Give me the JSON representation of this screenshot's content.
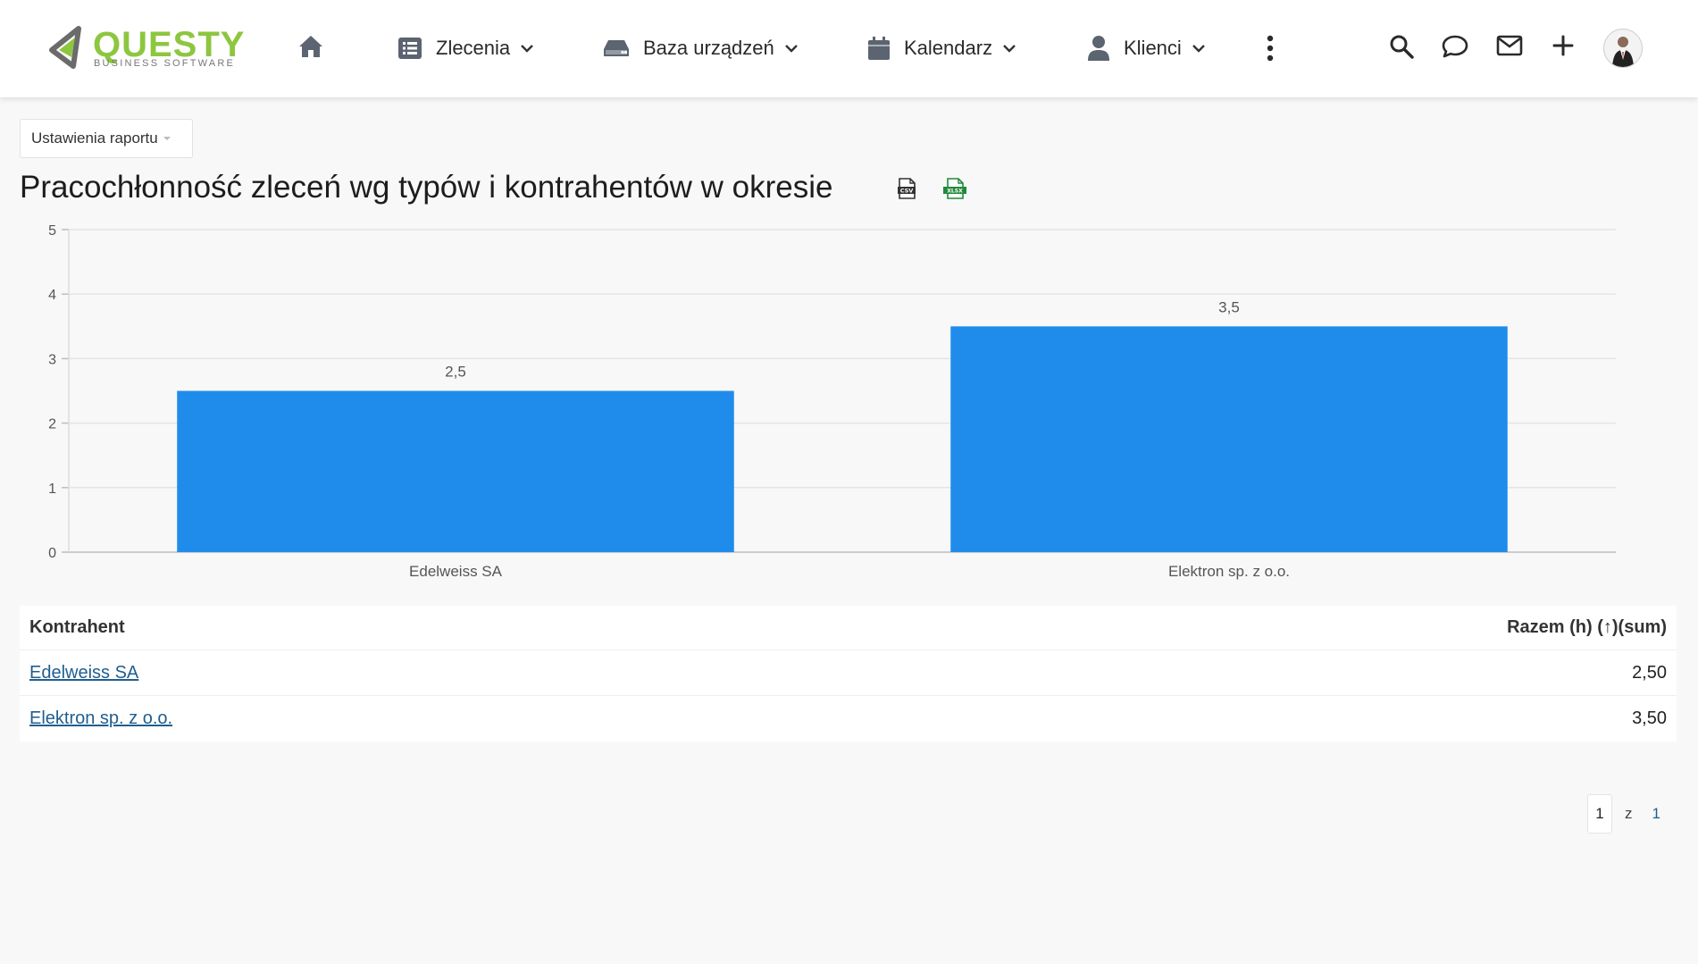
{
  "header": {
    "logo_text": "QUESTY",
    "logo_sub": "BUSINESS SOFTWARE",
    "nav": [
      {
        "label": "Zlecenia",
        "icon": "list-icon"
      },
      {
        "label": "Baza urządzeń",
        "icon": "hdd-icon"
      },
      {
        "label": "Kalendarz",
        "icon": "calendar-icon"
      },
      {
        "label": "Klienci",
        "icon": "user-icon"
      }
    ],
    "colors": {
      "logo_green": "#8dc63f",
      "logo_gray": "#6b6b6b"
    }
  },
  "settings": {
    "label": "Ustawienia raportu"
  },
  "report": {
    "title": "Pracochłonność zleceń wg typów i kontrahentów w okresie"
  },
  "chart_data": {
    "type": "bar",
    "categories": [
      "Edelweiss SA",
      "Elektron sp. z o.o."
    ],
    "values": [
      2.5,
      3.5
    ],
    "value_labels": [
      "2,5",
      "3,5"
    ],
    "ylim": [
      0,
      5
    ],
    "yticks": [
      "0",
      "1",
      "2",
      "3",
      "4",
      "5"
    ],
    "grid": true,
    "bar_color": "#1f8ceb"
  },
  "table": {
    "headers": {
      "contractor": "Kontrahent",
      "total": "Razem (h) (↑)(sum)"
    },
    "rows": [
      {
        "contractor": "Edelweiss SA",
        "total": "2,50"
      },
      {
        "contractor": "Elektron sp. z o.o.",
        "total": "3,50"
      }
    ]
  },
  "pagination": {
    "current": "1",
    "of": "z",
    "total": "1"
  }
}
